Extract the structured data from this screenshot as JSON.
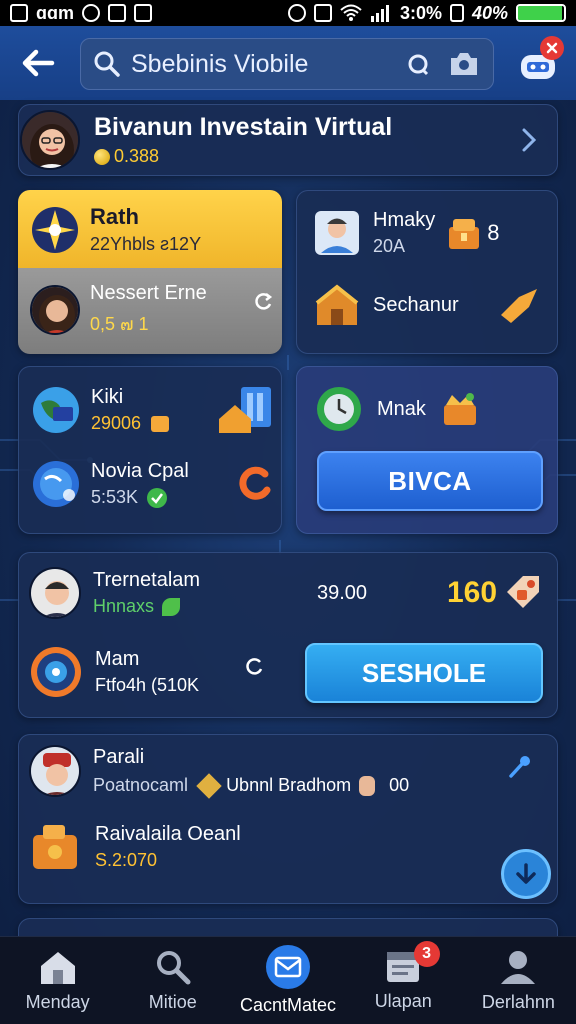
{
  "status_bar": {
    "left_text": "ɑɑm",
    "battery_text": "3:0%",
    "battery_text_2": "40%",
    "battery_level": 0.95
  },
  "header": {
    "search_text": "Sbebinis Viobile",
    "back_icon": "arrow-left-icon",
    "badge_icon": "close-icon"
  },
  "profile": {
    "name": "Bivanun Investain  Virtual",
    "coins": "0.388"
  },
  "card_a": {
    "title": "Rath",
    "subtitle": "22Yhbls ƨ12Y",
    "row2_title": "Nessert Erne",
    "row2_sub": "0,5 ๗ 1",
    "colors": {
      "top": "#f5c33b",
      "bottom": "#8c8c8c"
    }
  },
  "card_b": {
    "row1_title": "Hmaky",
    "row1_sub": "20A",
    "row1_value": "8",
    "row2_title": "Sechanur"
  },
  "card_c": {
    "row1_title": "Kiki",
    "row1_sub": "29006",
    "row2_title": "Novia Cpal",
    "row2_sub": "5:53K"
  },
  "card_d": {
    "title": "Mnak",
    "button_label": "BIVCA"
  },
  "card_e": {
    "row1_title": "Trernetalam",
    "row1_sub": "Hnnaxs",
    "row1_value": "39.00",
    "row1_score": "160",
    "row2_title": "Mam",
    "row2_sub": "Ftfo4h (510K",
    "button_label": "SESHOLE"
  },
  "card_f": {
    "row1_title": "Parali",
    "row1_sub_left": "Poatnocaml",
    "row1_sub_mid": "Ubnnl Bradhom",
    "row1_sub_right": "00",
    "row2_title": "Raivalaila Oeanl",
    "row2_sub": "S.2:070"
  },
  "bottom_nav": {
    "items": [
      {
        "label": "Menday",
        "icon": "home-icon"
      },
      {
        "label": "Mitioe",
        "icon": "search-icon"
      },
      {
        "label": "CacntMatec",
        "icon": "message-icon"
      },
      {
        "label": "Ulapan",
        "icon": "list-icon",
        "badge": "3"
      },
      {
        "label": "Derlahnn",
        "icon": "profile-icon"
      }
    ]
  }
}
